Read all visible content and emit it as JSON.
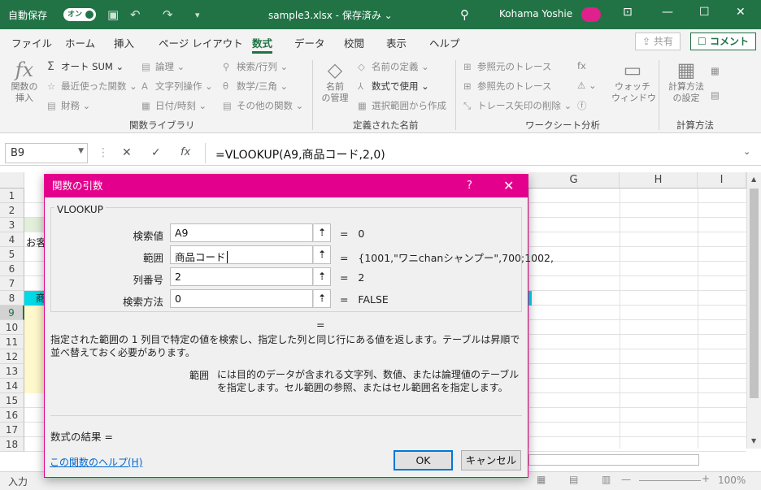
{
  "titlebar": {
    "autosave_label": "自動保存",
    "autosave_state": "オン",
    "filename": "sample3.xlsx - 保存済み",
    "filename_caret": "⌄",
    "user": "Kohama Yoshie"
  },
  "tabs": [
    "ファイル",
    "ホーム",
    "挿入",
    "ページ レイアウト",
    "数式",
    "データ",
    "校閲",
    "表示",
    "ヘルプ"
  ],
  "active_tab": "数式",
  "share": {
    "share_label": "共有",
    "comment_label": "コメント"
  },
  "ribbon": {
    "insert_function": "関数の\n挿入",
    "autosum": "オート SUM",
    "recent": "最近使った関数",
    "financial": "財務",
    "logical": "論理",
    "text": "文字列操作",
    "datetime": "日付/時刻",
    "lookup": "検索/行列",
    "math": "数学/三角",
    "more": "その他の関数",
    "group1": "関数ライブラリ",
    "name_manager": "名前\nの管理",
    "define_name": "名前の定義",
    "use_in_formula": "数式で使用",
    "create_from_sel": "選択範囲から作成",
    "group2": "定義された名前",
    "trace_precedents": "参照元のトレース",
    "trace_dependents": "参照先のトレース",
    "remove_arrows": "トレース矢印の削除",
    "group3": "ワークシート分析",
    "watch_window": "ウォッチ\nウィンドウ",
    "calc_options": "計算方法\nの設定",
    "group4": "計算方法"
  },
  "formula_bar": {
    "namebox": "B9",
    "fx": "fx",
    "formula": "=VLOOKUP(A9,商品コード,2,0)"
  },
  "grid": {
    "columns": [
      "G",
      "H",
      "I"
    ],
    "rows": [
      "1",
      "2",
      "3",
      "4",
      "5",
      "6",
      "7",
      "8",
      "9",
      "10",
      "11",
      "12",
      "13",
      "14",
      "15",
      "16",
      "17",
      "18"
    ],
    "selected_row": "9",
    "visible_cell_a4": "お客",
    "visible_cell_a8": "商"
  },
  "dialog": {
    "title": "関数の引数",
    "help_glyph": "?",
    "function_name": "VLOOKUP",
    "args": [
      {
        "label": "検索値",
        "value": "A9",
        "result": "0"
      },
      {
        "label": "範囲",
        "value": "商品コード",
        "result": "{1001,\"ワニchanシャンプー\",700;1002,"
      },
      {
        "label": "列番号",
        "value": "2",
        "result": "2"
      },
      {
        "label": "検索方法",
        "value": "0",
        "result": "FALSE"
      }
    ],
    "result_equals": "=",
    "description": "指定された範囲の 1 列目で特定の値を検索し、指定した列と同じ行にある値を返します。テーブルは昇順で並べ替えておく必要があります。",
    "arg_name": "範囲",
    "arg_desc": "には目的のデータが含まれる文字列、数値、または論理値のテーブルを指定します。セル範囲の参照、またはセル範囲名を指定します。",
    "formula_result": "数式の結果 =",
    "help_link": "この関数のヘルプ(H)",
    "ok": "OK",
    "cancel": "キャンセル"
  },
  "status": {
    "mode": "入力",
    "zoom": "100%"
  },
  "colors": {
    "excel_green": "#217346",
    "dialog_accent": "#e3008c",
    "link": "#0066cc"
  }
}
